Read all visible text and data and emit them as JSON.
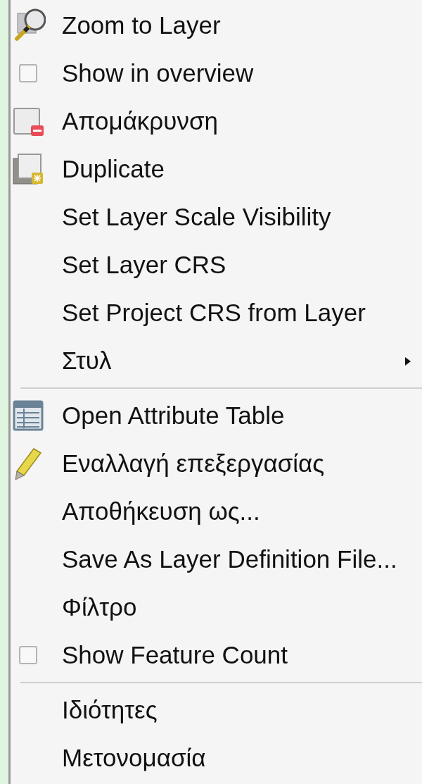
{
  "menu": {
    "sections": [
      {
        "items": [
          {
            "kind": "icon",
            "label": "Zoom to Layer"
          },
          {
            "kind": "checkbox",
            "label": "Show in overview",
            "checked": false
          },
          {
            "kind": "icon",
            "label": "Απομάκρυνση"
          },
          {
            "kind": "icon",
            "label": "Duplicate"
          },
          {
            "kind": "plain",
            "label": "Set Layer Scale Visibility"
          },
          {
            "kind": "plain",
            "label": "Set Layer CRS"
          },
          {
            "kind": "plain",
            "label": "Set Project CRS from Layer"
          },
          {
            "kind": "submenu",
            "label": "Στυλ"
          }
        ]
      },
      {
        "items": [
          {
            "kind": "icon",
            "label": "Open Attribute Table"
          },
          {
            "kind": "icon",
            "label": "Εναλλαγή επεξεργασίας"
          },
          {
            "kind": "plain",
            "label": "Αποθήκευση ως..."
          },
          {
            "kind": "plain",
            "label": "Save As Layer Definition File..."
          },
          {
            "kind": "plain",
            "label": "Φίλτρο"
          },
          {
            "kind": "checkbox",
            "label": "Show Feature Count",
            "checked": false
          }
        ]
      },
      {
        "items": [
          {
            "kind": "plain",
            "label": "Ιδιότητες"
          },
          {
            "kind": "plain",
            "label": "Μετονομασία"
          }
        ]
      }
    ]
  }
}
